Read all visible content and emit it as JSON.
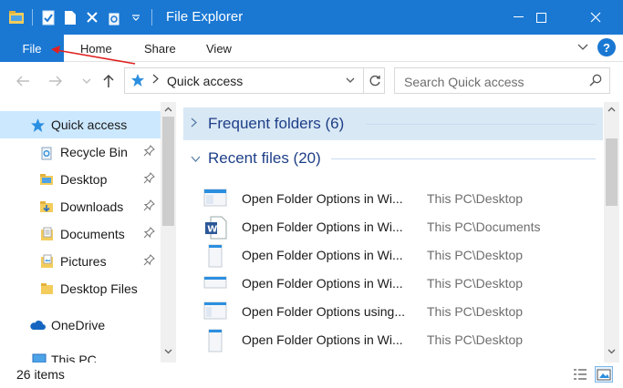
{
  "window": {
    "title": "File Explorer",
    "controls": {
      "minimize": "—",
      "maximize": "☐",
      "close": "✕"
    }
  },
  "ribbon": {
    "tabs": [
      "File",
      "Home",
      "Share",
      "View"
    ],
    "help_label": "?"
  },
  "address": {
    "path": "Quick access",
    "search_placeholder": "Search Quick access"
  },
  "nav_pane": {
    "items": [
      {
        "label": "Quick access",
        "icon": "star-icon",
        "selected": true,
        "pinned": false
      },
      {
        "label": "Recycle Bin",
        "icon": "recycle-bin-icon",
        "pinned": true
      },
      {
        "label": "Desktop",
        "icon": "folder-icon",
        "pinned": true
      },
      {
        "label": "Downloads",
        "icon": "folder-icon",
        "pinned": true
      },
      {
        "label": "Documents",
        "icon": "documents-icon",
        "pinned": true
      },
      {
        "label": "Pictures",
        "icon": "pictures-icon",
        "pinned": true
      },
      {
        "label": "Desktop Files",
        "icon": "folder-icon",
        "pinned": false
      },
      {
        "label": "OneDrive",
        "icon": "cloud-icon",
        "pinned": false
      },
      {
        "label": "This PC",
        "icon": "pc-icon",
        "pinned": false
      }
    ]
  },
  "content": {
    "groups": [
      {
        "label": "Frequent folders (6)",
        "expanded": false
      },
      {
        "label": "Recent files (20)",
        "expanded": true
      }
    ],
    "files": [
      {
        "name": "Open Folder Options in Wi...",
        "location": "This PC\\Desktop",
        "icon": "image-thumbnail-icon"
      },
      {
        "name": "Open Folder Options in Wi...",
        "location": "This PC\\Documents",
        "icon": "word-document-icon"
      },
      {
        "name": "Open Folder Options in Wi...",
        "location": "This PC\\Desktop",
        "icon": "image-thumbnail-icon"
      },
      {
        "name": "Open Folder Options in Wi...",
        "location": "This PC\\Desktop",
        "icon": "image-thumbnail-icon"
      },
      {
        "name": "Open Folder Options using...",
        "location": "This PC\\Desktop",
        "icon": "image-thumbnail-icon"
      },
      {
        "name": "Open Folder Options in Wi...",
        "location": "This PC\\Desktop",
        "icon": "image-thumbnail-icon"
      }
    ]
  },
  "status": {
    "item_count": "26 items"
  },
  "colors": {
    "accent": "#1a78d3",
    "selection": "#cce8ff",
    "group_header": "#1e3f87",
    "annotation_arrow": "#e02020"
  }
}
